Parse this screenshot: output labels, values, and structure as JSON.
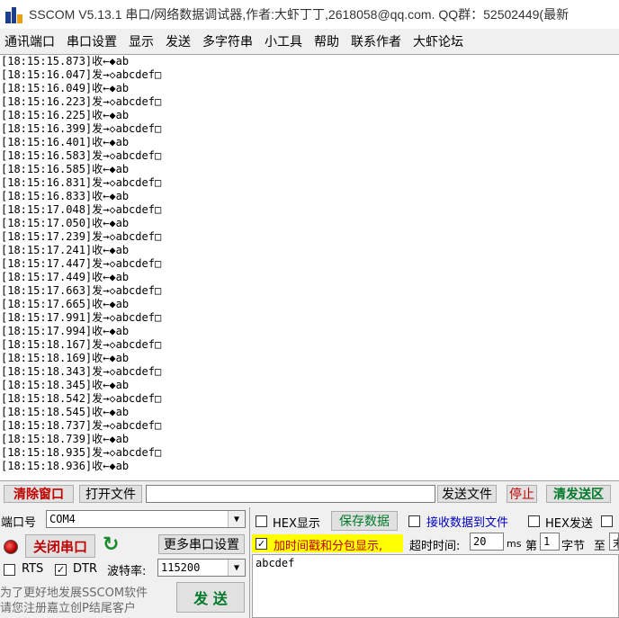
{
  "window": {
    "title": "SSCOM V5.13.1 串口/网络数据调试器,作者:大虾丁丁,2618058@qq.com. QQ群：52502449(最新"
  },
  "menu": {
    "items": [
      "通讯端口",
      "串口设置",
      "显示",
      "发送",
      "多字符串",
      "小工具",
      "帮助",
      "联系作者",
      "大虾论坛"
    ]
  },
  "log": {
    "lines": [
      "[18:15:15.873]收←◆ab",
      "[18:15:16.047]发→◇abcdef□",
      "[18:15:16.049]收←◆ab",
      "[18:15:16.223]发→◇abcdef□",
      "[18:15:16.225]收←◆ab",
      "[18:15:16.399]发→◇abcdef□",
      "[18:15:16.401]收←◆ab",
      "[18:15:16.583]发→◇abcdef□",
      "[18:15:16.585]收←◆ab",
      "[18:15:16.831]发→◇abcdef□",
      "[18:15:16.833]收←◆ab",
      "[18:15:17.048]发→◇abcdef□",
      "[18:15:17.050]收←◆ab",
      "[18:15:17.239]发→◇abcdef□",
      "[18:15:17.241]收←◆ab",
      "[18:15:17.447]发→◇abcdef□",
      "[18:15:17.449]收←◆ab",
      "[18:15:17.663]发→◇abcdef□",
      "[18:15:17.665]收←◆ab",
      "[18:15:17.991]发→◇abcdef□",
      "[18:15:17.994]收←◆ab",
      "[18:15:18.167]发→◇abcdef□",
      "[18:15:18.169]收←◆ab",
      "[18:15:18.343]发→◇abcdef□",
      "[18:15:18.345]收←◆ab",
      "[18:15:18.542]发→◇abcdef□",
      "[18:15:18.545]收←◆ab",
      "[18:15:18.737]发→◇abcdef□",
      "[18:15:18.739]收←◆ab",
      "[18:15:18.935]发→◇abcdef□",
      "[18:15:18.936]收←◆ab"
    ]
  },
  "toolbar": {
    "clear_window": "清除窗口",
    "open_file": "打开文件",
    "file_path": "",
    "send_file": "发送文件",
    "stop": "停止",
    "clear_send": "清发送区"
  },
  "port": {
    "port_label": "端口号",
    "port_value": "COM4",
    "close_port": "关闭串口",
    "more_settings": "更多串口设置",
    "rts_label": "RTS",
    "dtr_label": "DTR",
    "baud_label": "波特率:",
    "baud_value": "115200",
    "rts_checked": false,
    "dtr_checked": true
  },
  "options": {
    "hex_display": "HEX显示",
    "save_data": "保存数据",
    "receive_to_file": "接收数据到文件",
    "hex_send": "HEX发送",
    "timestamp": "加时间戳和分包显示,",
    "timeout_label": "超时时间:",
    "timeout_value": "20",
    "timeout_unit": "ms",
    "byte_prefix": "第",
    "byte_value": "1",
    "byte_suffix": "字节",
    "to_label": "至",
    "to_value": "末"
  },
  "send": {
    "text": "abcdef",
    "send_button": "发 送"
  },
  "promo": {
    "line1": "为了更好地发展SSCOM软件",
    "line2": "请您注册嘉立创P结尾客户"
  },
  "colors": {
    "accent_red": "#c00000",
    "accent_green": "#007a2a",
    "highlight_yellow": "#ffff00"
  }
}
